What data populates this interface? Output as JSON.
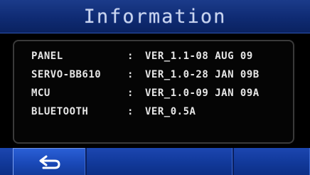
{
  "header": {
    "title": "Information"
  },
  "info": {
    "rows": [
      {
        "label": "PANEL",
        "separator": ":",
        "value": "VER_1.1-08 AUG 09"
      },
      {
        "label": "SERVO-BB610",
        "separator": ":",
        "value": "VER_1.0-28 JAN 09B"
      },
      {
        "label": "MCU",
        "separator": ":",
        "value": "VER_1.0-09 JAN 09A"
      },
      {
        "label": "BLUETOOTH",
        "separator": ":",
        "value": "VER_0.5A"
      }
    ]
  },
  "toolbar": {
    "back_icon": "return-arrow-icon"
  },
  "colors": {
    "title_bar": "#0f2b73",
    "text": "#e6e6e6",
    "button": "#1a49b8"
  }
}
